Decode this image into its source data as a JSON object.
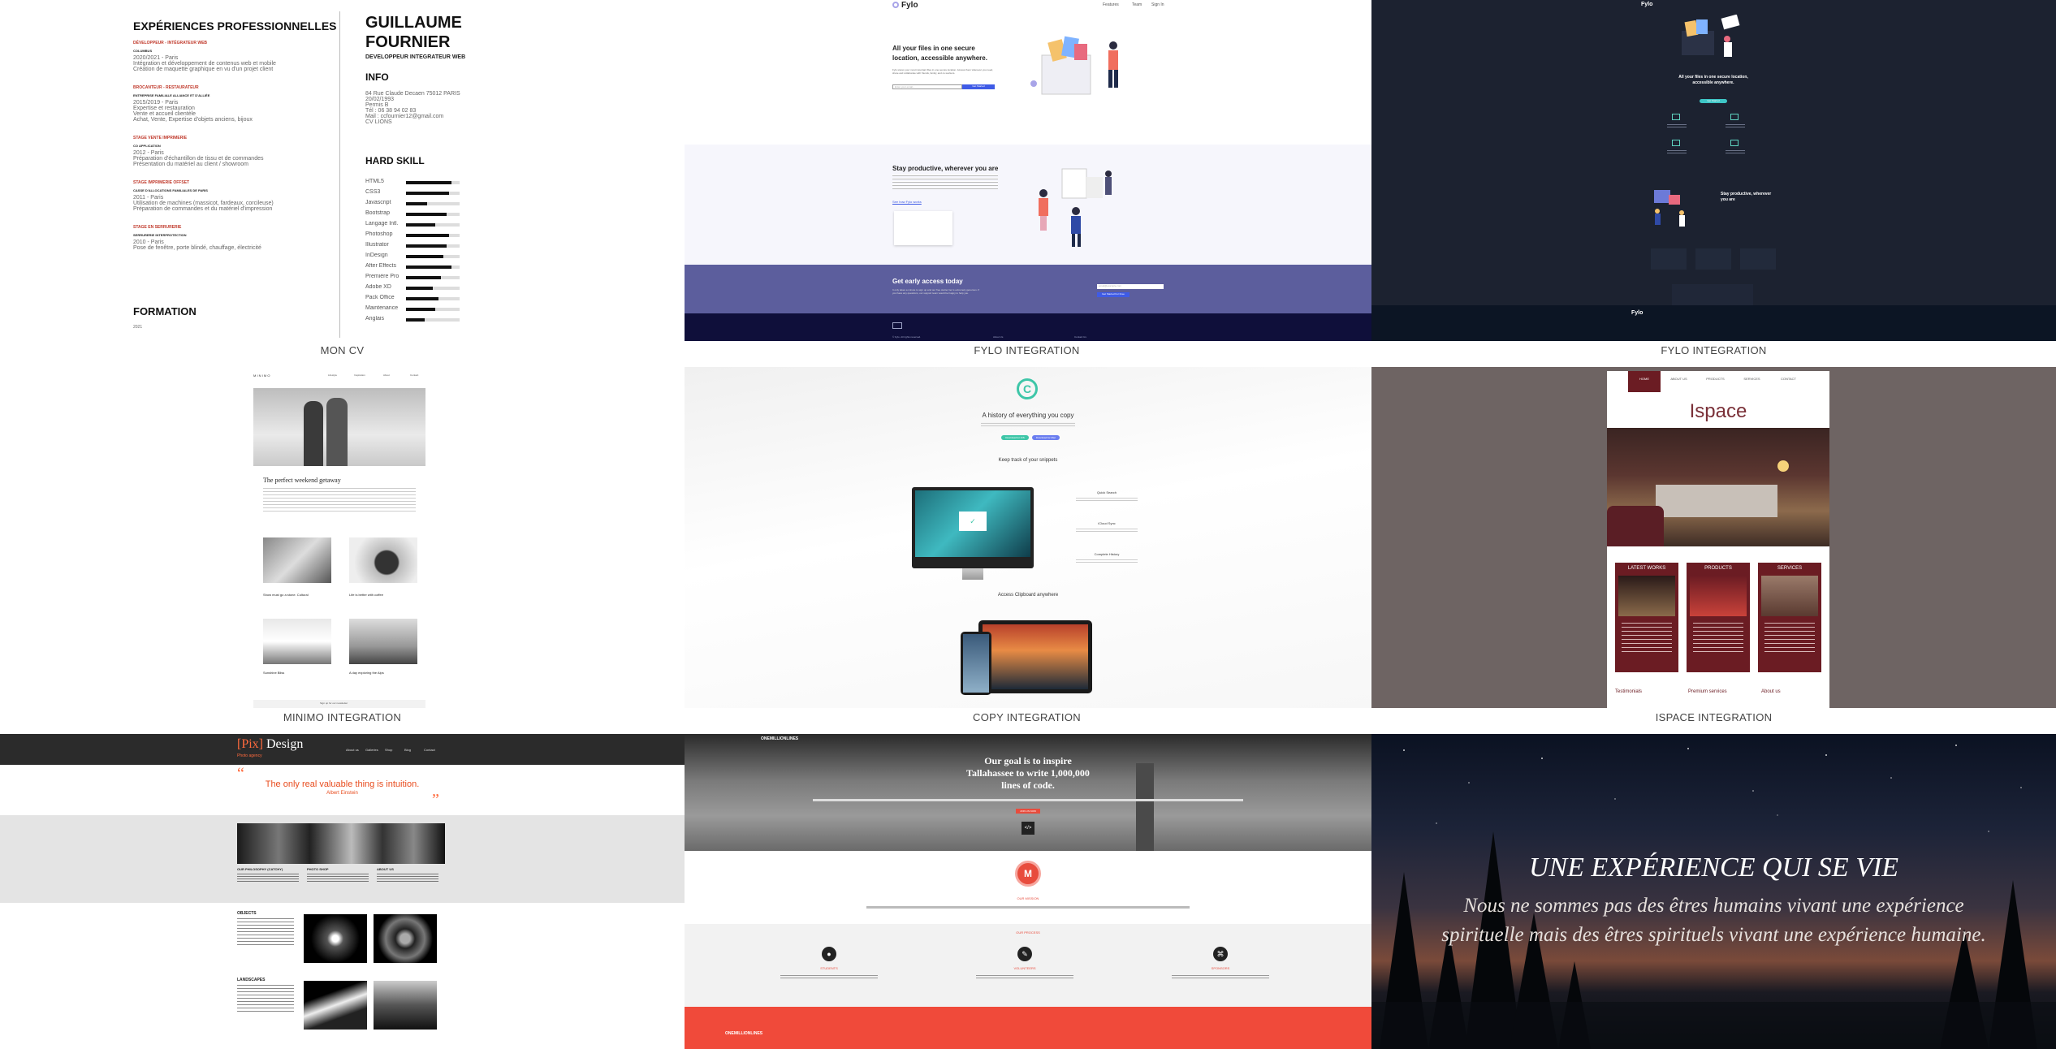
{
  "captions": [
    "MON CV",
    "FYLO INTEGRATION",
    "FYLO INTEGRATION",
    "MINIMO INTEGRATION",
    "COPY INTEGRATION",
    "ISPACE INTEGRATION"
  ],
  "cv": {
    "section_exp": "EXPÉRIENCES PROFESSIONNELLES",
    "name_line1": "GUILLAUME",
    "name_line2": "FOURNIER",
    "role": "DEVELOPPEUR INTEGRATEUR WEB",
    "info_title": "INFO",
    "info_lines": [
      "84 Rue Claude Decaen 75012 PARIS",
      "20/02/1993",
      "Permis B",
      "Tél : 06 38 94 02 83",
      "Mail : ccfournier12@gmail.com",
      "CV LIONS"
    ],
    "hard_skill_title": "HARD SKILL",
    "skills": [
      {
        "name": "HTML5",
        "level": 0.85
      },
      {
        "name": "CSS3",
        "level": 0.8
      },
      {
        "name": "Javascript",
        "level": 0.4
      },
      {
        "name": "Bootstrap",
        "level": 0.75
      },
      {
        "name": "Langage Intl.",
        "level": 0.55
      },
      {
        "name": "Photoshop",
        "level": 0.8
      },
      {
        "name": "Illustrator",
        "level": 0.75
      },
      {
        "name": "InDesign",
        "level": 0.7
      },
      {
        "name": "After Effects",
        "level": 0.85
      },
      {
        "name": "Première Pro",
        "level": 0.65
      },
      {
        "name": "Adobe XD",
        "level": 0.5
      },
      {
        "name": "Pack Office",
        "level": 0.6
      },
      {
        "name": "Maintenance",
        "level": 0.55
      },
      {
        "name": "Anglais",
        "level": 0.35
      }
    ],
    "jobs": [
      {
        "title": "DÉVELOPPEUR - INTÉGRATEUR WEB",
        "company": "COLUMBUS",
        "lines": [
          "2020/2021 - Paris",
          "Intégration et développement de contenus web et mobile",
          "Création de maquette graphique en vu d'un projet client"
        ]
      },
      {
        "title": "BROCANTEUR - RESTAURATEUR",
        "company": "ENTREPRISE FAMILIALE ALLIANCE ET D'ALLIÉE",
        "lines": [
          "2015/2019 - Paris",
          "Expertise et restauration",
          "Vente et accueil clientèle",
          "Achat, Vente, Expertise d'objets anciens, bijoux"
        ]
      },
      {
        "title": "STAGE VENTE IMPRIMERIE",
        "company": "CO APPLICATION",
        "lines": [
          "2012 - Paris",
          "Préparation d'échantillon de tissu et de commandes",
          "Présentation du matériel au client / showroom"
        ]
      },
      {
        "title": "STAGE IMPRIMERIE OFFSET",
        "company": "CASSE D'ALLOCATIONS FAMILIALES DE PARIS",
        "lines": [
          "2011 - Paris",
          "Utilisation de machines (massicot, fardeaux, corcileuse)",
          "Préparation de commandes et du matériel d'impression"
        ]
      },
      {
        "title": "STAGE EN SERRURERIE",
        "company": "SERRURERIE INTERPROTECTION",
        "lines": [
          "2010 - Paris",
          "Pose de fenêtre, porte blindé, chauffage, électricité"
        ]
      }
    ],
    "formation_title": "FORMATION",
    "formation_year": "2021"
  },
  "fylo": {
    "logo": "Fylo",
    "nav": [
      "Features",
      "Team",
      "Sign In"
    ],
    "hero_title": "All your files in one secure location, accessible anywhere.",
    "hero_text": "Fylo stores your most important files in one secure location. Access them wherever you need, share and collaborate with friends, family, and co-workers.",
    "email_placeholder": "Enter your email...",
    "cta": "Get Started",
    "productive_title": "Stay productive, wherever you are",
    "productive_link": "See how Fylo works",
    "early_title": "Get early access today",
    "early_text": "It only takes a minute to sign up and our free starter tier is extremely generous. If you have any questions, our support team would be happy to help you.",
    "early_placeholder": "email@example.com",
    "early_btn": "Get Started For Free",
    "footer_text": "© Fylo. All rights reserved.",
    "footer_links": [
      "About Us",
      "Contact Us"
    ]
  },
  "fylo_dark": {
    "logo": "Fylo",
    "hero_title": "All your files in one secure location, accessible anywhere.",
    "cta": "Get Started",
    "productive_title": "Stay productive, wherever you are"
  },
  "minimo": {
    "logo": "M I N I M O",
    "nav": [
      "Lifestyle",
      "Inspiration",
      "About",
      "Contact"
    ],
    "post_title": "The perfect weekend getaway",
    "cards": [
      "Show must go a stone. Cultural",
      "Life is better with coffee",
      "Sunshine Bliss",
      "A day exploring the Alps"
    ],
    "footer": "Sign up for our newsletter"
  },
  "copy": {
    "title": "A history of everything you copy",
    "btn1": "Download for iOS",
    "btn2": "Download for Mac",
    "track_title": "Keep track of your snippets",
    "features": [
      "Quick Search",
      "iCloud Sync",
      "Complete History"
    ],
    "access_title": "Access Clipboard anywhere"
  },
  "ispace": {
    "nav": [
      "HOME",
      "ABOUT US",
      "PRODUCTS",
      "SERVICES",
      "CONTACT"
    ],
    "title": "Ispace",
    "panels": [
      "LATEST WORKS",
      "PRODUCTS",
      "SERVICES"
    ],
    "footer_cols": [
      "Testimonials",
      "Premium services",
      "About us"
    ]
  },
  "pix": {
    "logo_bracket": "[Pix]",
    "logo_rest": "Design",
    "tagline": "Photo agency",
    "nav": [
      "About us",
      "Galleries",
      "Shop",
      "Blog",
      "Contact"
    ],
    "quote": "The only real valuable thing is intuition.",
    "author": "Albert Einstein",
    "cols": [
      "OUR PHILOSOPHY (CATCHY)",
      "PHOTO SHOP",
      "ABOUT US"
    ],
    "sec1": "OBJECTS",
    "sec2": "LANDSCAPES"
  },
  "oneml": {
    "logo": "ONEMILLIONLINES",
    "headline_l1": "Our goal is to inspire",
    "headline_l2": "Tallahassee to write 1,000,000",
    "headline_l3": "lines of code.",
    "cta": "JOIN US NOW",
    "mission": "OUR MISSION",
    "process": "OUR PROCESS",
    "icons": [
      "STUDENTS",
      "VOLUNTEERS",
      "SPONSORS"
    ],
    "footer_logo": "ONEMILLIONLINES"
  },
  "exp": {
    "title": "UNE EXPÉRIENCE QUI SE VIE",
    "line1": "Nous ne sommes pas des êtres humains vivant une expérience",
    "line2": "spirituelle mais des êtres spirituels vivant une expérience humaine."
  }
}
